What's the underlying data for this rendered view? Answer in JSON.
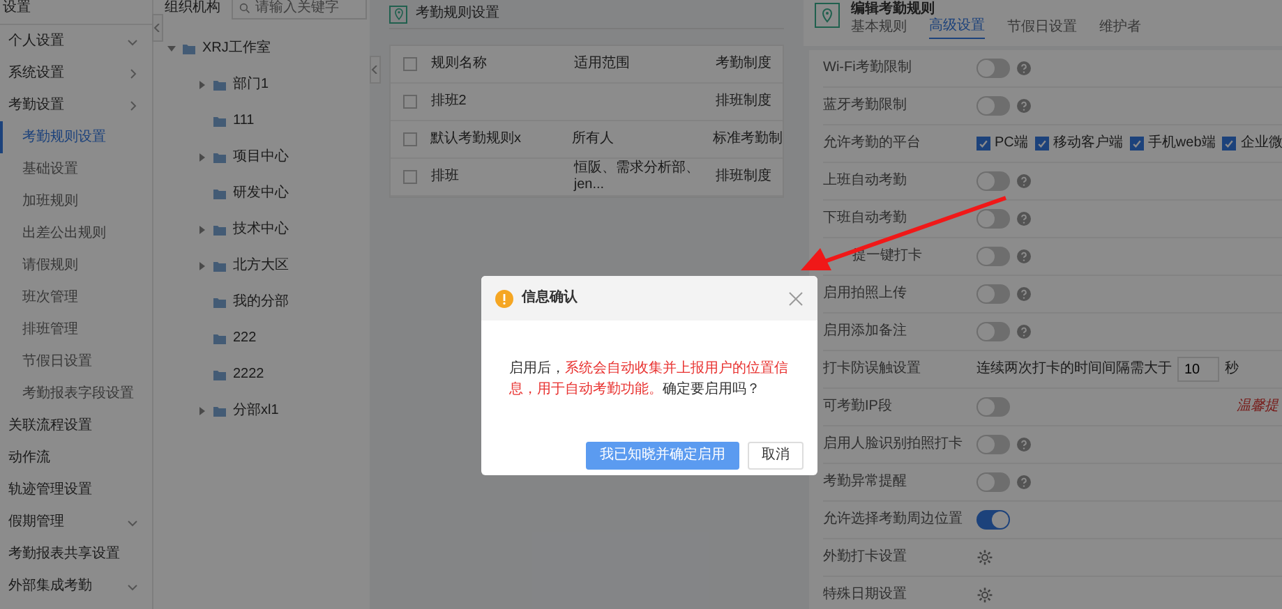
{
  "sidebar": {
    "title": "设置",
    "items": [
      {
        "label": "个人设置",
        "kind": "dropdown",
        "selected": false
      },
      {
        "label": "系统设置",
        "kind": "submenu",
        "selected": false
      },
      {
        "label": "考勤设置",
        "kind": "submenu",
        "selected": false,
        "children": [
          {
            "label": "考勤规则设置",
            "selected": true
          },
          {
            "label": "基础设置",
            "selected": false
          },
          {
            "label": "加班规则",
            "selected": false
          },
          {
            "label": "出差公出规则",
            "selected": false
          },
          {
            "label": "请假规则",
            "selected": false
          },
          {
            "label": "班次管理",
            "selected": false
          },
          {
            "label": "排班管理",
            "selected": false
          },
          {
            "label": "节假日设置",
            "selected": false
          },
          {
            "label": "考勤报表字段设置",
            "selected": false
          }
        ]
      },
      {
        "label": "关联流程设置",
        "selected": false
      },
      {
        "label": "动作流",
        "selected": false
      },
      {
        "label": "轨迹管理设置",
        "selected": false
      },
      {
        "label": "假期管理",
        "kind": "dropdown",
        "selected": false
      },
      {
        "label": "考勤报表共享设置",
        "selected": false
      },
      {
        "label": "外部集成考勤",
        "kind": "dropdown",
        "selected": false
      }
    ]
  },
  "org_panel": {
    "title": "组织机构",
    "search": {
      "placeholder": "请输入关键字"
    },
    "tree": [
      {
        "label": "XRJ工作室",
        "expanded": true,
        "children": [
          {
            "label": "部门1",
            "expanded": false
          },
          {
            "label": "111"
          },
          {
            "label": "项目中心",
            "expanded": false
          },
          {
            "label": "研发中心"
          },
          {
            "label": "技术中心",
            "expanded": false
          },
          {
            "label": "北方大区",
            "expanded": false
          },
          {
            "label": "我的分部"
          },
          {
            "label": "222"
          },
          {
            "label": "2222"
          },
          {
            "label": "分部xl1",
            "expanded": false
          }
        ]
      }
    ]
  },
  "rules_panel": {
    "title": "考勤规则设置",
    "table": {
      "all_checked": false,
      "columns": [
        "规则名称",
        "适用范围",
        "考勤制度"
      ],
      "rows": [
        {
          "checked": false,
          "cells": [
            "排班2",
            "",
            "排班制度"
          ]
        },
        {
          "checked": false,
          "cells": [
            "默认考勤规则x",
            "所有人",
            "标准考勤制"
          ]
        },
        {
          "checked": false,
          "cells": [
            "排班",
            "恒阪、需求分析部、jen...",
            "排班制度"
          ]
        }
      ]
    }
  },
  "edit_panel": {
    "title": "编辑考勤规则",
    "tabs": [
      {
        "label": "基本规则",
        "selected": false
      },
      {
        "label": "高级设置",
        "selected": true
      },
      {
        "label": "节假日设置",
        "selected": false
      },
      {
        "label": "维护者",
        "selected": false
      }
    ],
    "settings": [
      {
        "kind": "toggle",
        "label": "Wi-Fi考勤限制",
        "on": false,
        "help": true
      },
      {
        "kind": "toggle",
        "label": "蓝牙考勤限制",
        "on": false,
        "help": true
      },
      {
        "kind": "checkboxes",
        "label": "允许考勤的平台",
        "options": [
          {
            "label": "PC端",
            "checked": true
          },
          {
            "label": "移动客户端",
            "checked": true
          },
          {
            "label": "手机web端",
            "checked": true
          },
          {
            "label": "企业微",
            "checked": true
          }
        ]
      },
      {
        "kind": "toggle",
        "label": "上班自动考勤",
        "on": false,
        "help": true
      },
      {
        "kind": "toggle",
        "label": "下班自动考勤",
        "on": false,
        "help": true
      },
      {
        "kind": "toggle",
        "label": "提一键打卡",
        "obscured": true,
        "on": false,
        "help": true
      },
      {
        "kind": "toggle",
        "label": "启用拍照上传",
        "on": false,
        "help": true
      },
      {
        "kind": "toggle",
        "label": "启用添加备注",
        "on": false,
        "help": true
      },
      {
        "kind": "interval",
        "label": "打卡防误触设置",
        "prefix": "连续两次打卡的时间间隔需大于",
        "value": "10",
        "unit": "秒"
      },
      {
        "kind": "toggle",
        "label": "可考勤IP段",
        "on": false,
        "help": false,
        "note": "温馨提"
      },
      {
        "kind": "toggle",
        "label": "启用人脸识别拍照打卡",
        "on": false,
        "help": true
      },
      {
        "kind": "toggle",
        "label": "考勤异常提醒",
        "on": false,
        "help": true
      },
      {
        "kind": "toggle",
        "label": "允许选择考勤周边位置",
        "on": true,
        "help": false
      },
      {
        "kind": "gear",
        "label": "外勤打卡设置"
      },
      {
        "kind": "gear",
        "label": "特殊日期设置"
      }
    ]
  },
  "dialog": {
    "title": "信息确认",
    "message": [
      {
        "text": "启用后，",
        "highlight": false
      },
      {
        "text": "系统会自动收集并上报用户的位置信息，用于自动考勤功能。",
        "highlight": true
      },
      {
        "text": "确定要启用吗？",
        "highlight": false
      }
    ],
    "buttons": [
      {
        "label": "我已知晓并确定启用",
        "kind": "primary"
      },
      {
        "label": "取消",
        "kind": "secondary"
      }
    ]
  }
}
